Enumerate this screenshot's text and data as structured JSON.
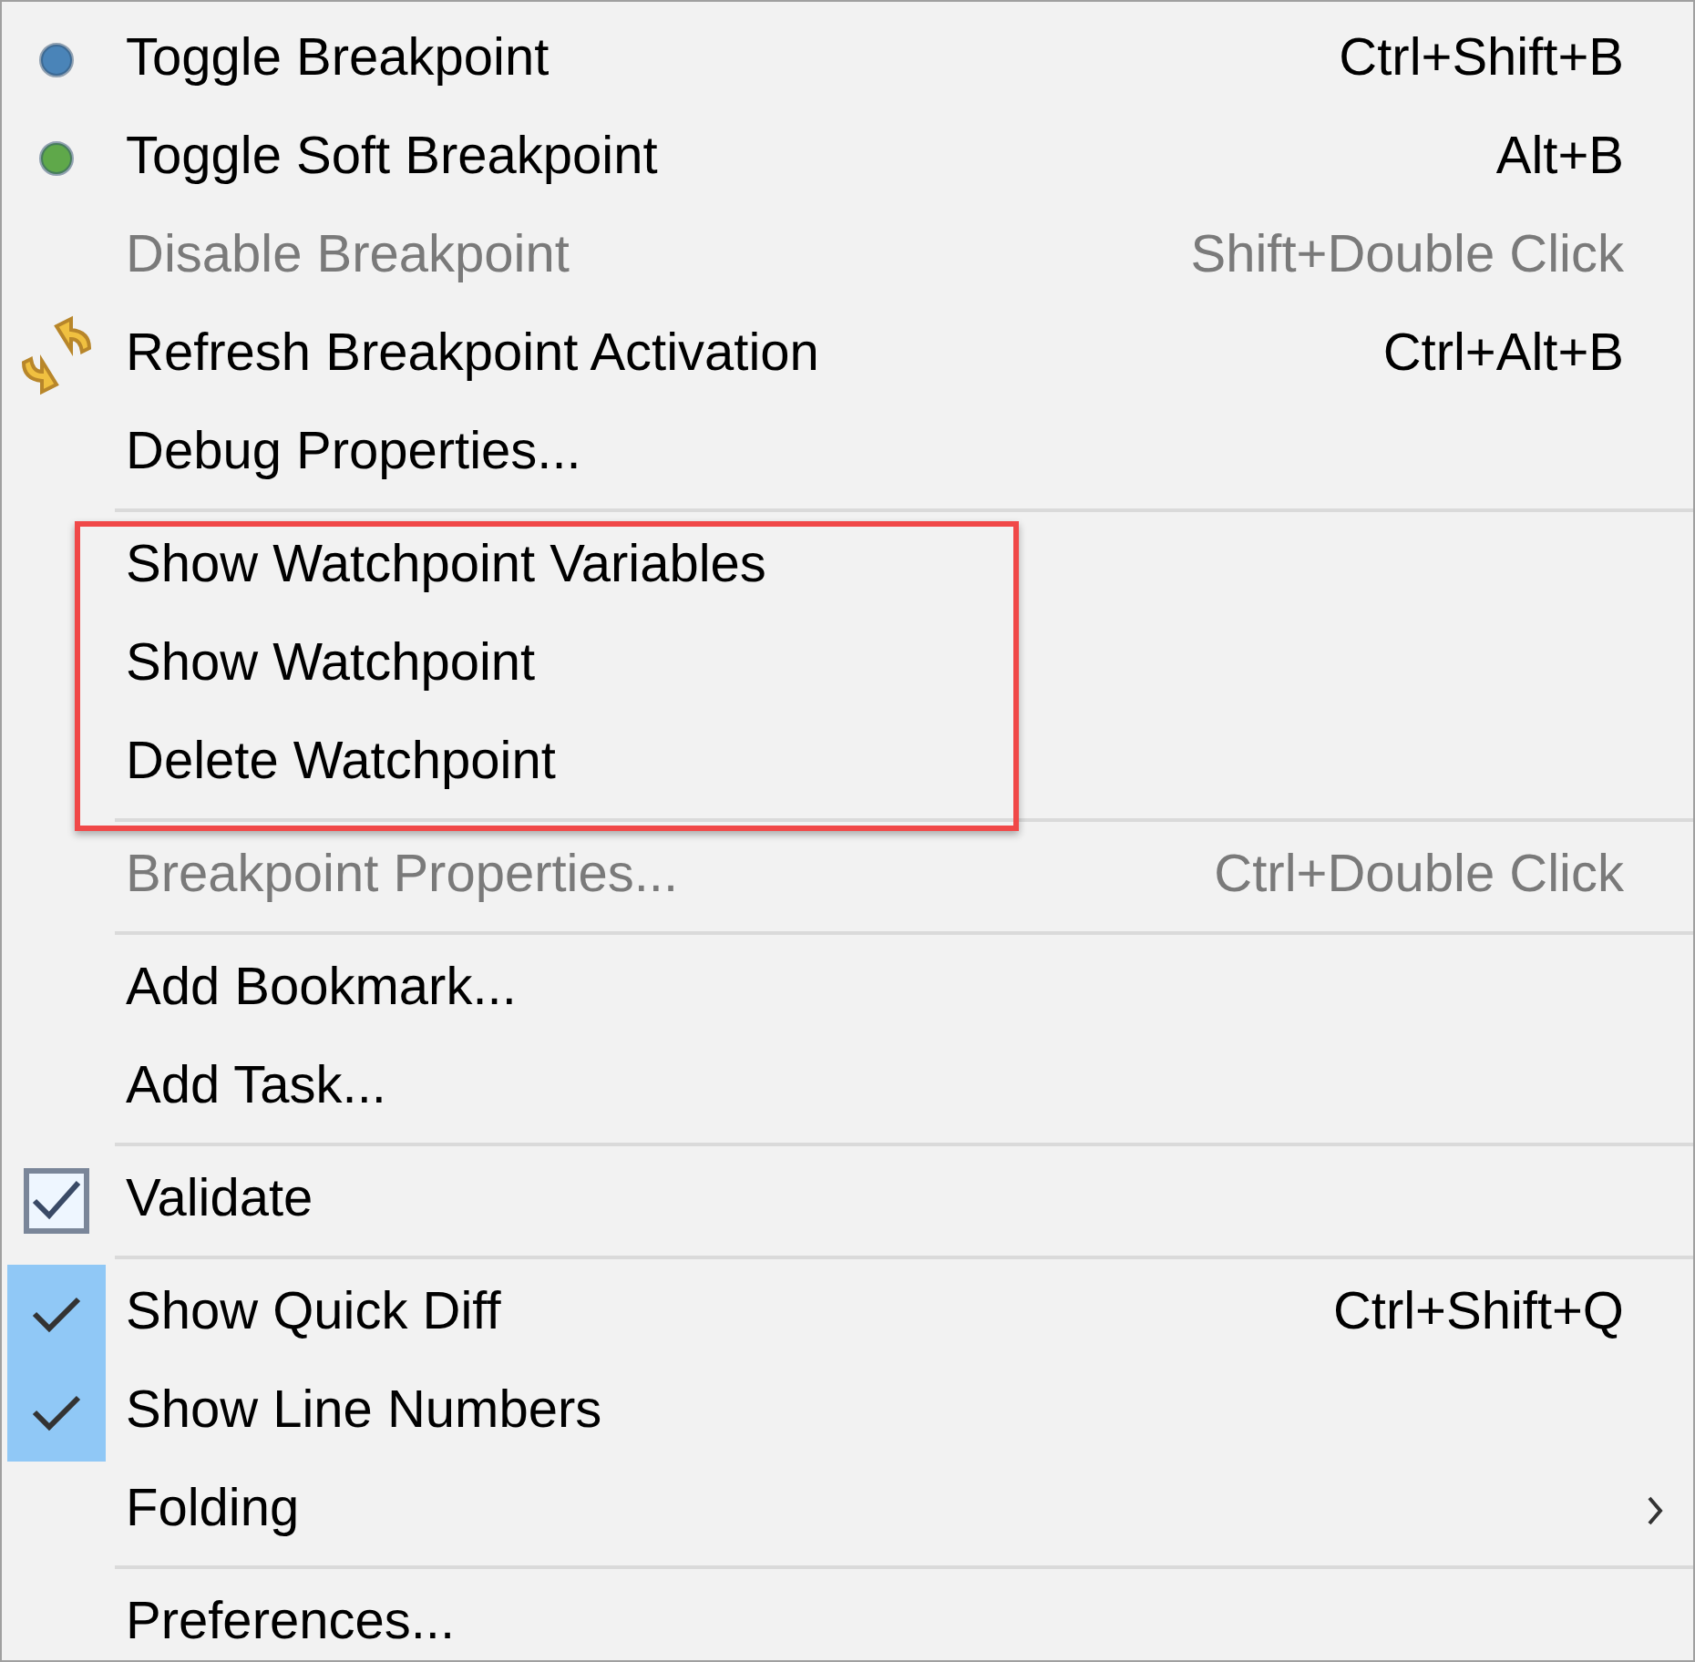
{
  "sections": [
    {
      "highlighted": false,
      "items": [
        {
          "kind": "dot",
          "color": "#4a84b8",
          "label": "Toggle Breakpoint",
          "shortcut": "Ctrl+Shift+B",
          "disabled": false
        },
        {
          "kind": "dot",
          "color": "#5fa84a",
          "label": "Toggle Soft Breakpoint",
          "shortcut": "Alt+B",
          "disabled": false
        },
        {
          "kind": "plain",
          "label": "Disable Breakpoint",
          "shortcut": "Shift+Double Click",
          "disabled": true
        },
        {
          "kind": "refresh",
          "label": "Refresh Breakpoint Activation",
          "shortcut": "Ctrl+Alt+B",
          "disabled": false
        },
        {
          "kind": "plain",
          "label": "Debug Properties...",
          "disabled": false
        }
      ]
    },
    {
      "highlighted": true,
      "items": [
        {
          "kind": "plain",
          "label": "Show Watchpoint Variables",
          "disabled": false
        },
        {
          "kind": "plain",
          "label": "Show Watchpoint",
          "disabled": false
        },
        {
          "kind": "plain",
          "label": "Delete Watchpoint",
          "disabled": false
        }
      ]
    },
    {
      "highlighted": false,
      "items": [
        {
          "kind": "plain",
          "label": "Breakpoint Properties...",
          "shortcut": "Ctrl+Double Click",
          "disabled": true
        }
      ]
    },
    {
      "highlighted": false,
      "items": [
        {
          "kind": "plain",
          "label": "Add Bookmark...",
          "disabled": false
        },
        {
          "kind": "plain",
          "label": "Add Task...",
          "disabled": false
        }
      ]
    },
    {
      "highlighted": false,
      "items": [
        {
          "kind": "checkbox",
          "checked": true,
          "label": "Validate",
          "disabled": false
        }
      ]
    },
    {
      "highlighted": false,
      "items": [
        {
          "kind": "toggle",
          "checked": true,
          "label": "Show Quick Diff",
          "shortcut": "Ctrl+Shift+Q",
          "disabled": false
        },
        {
          "kind": "toggle",
          "checked": true,
          "label": "Show Line Numbers",
          "disabled": false
        },
        {
          "kind": "submenu",
          "label": "Folding",
          "disabled": false
        }
      ]
    },
    {
      "highlighted": false,
      "items": [
        {
          "kind": "plain",
          "label": "Preferences...",
          "disabled": false
        }
      ]
    }
  ]
}
